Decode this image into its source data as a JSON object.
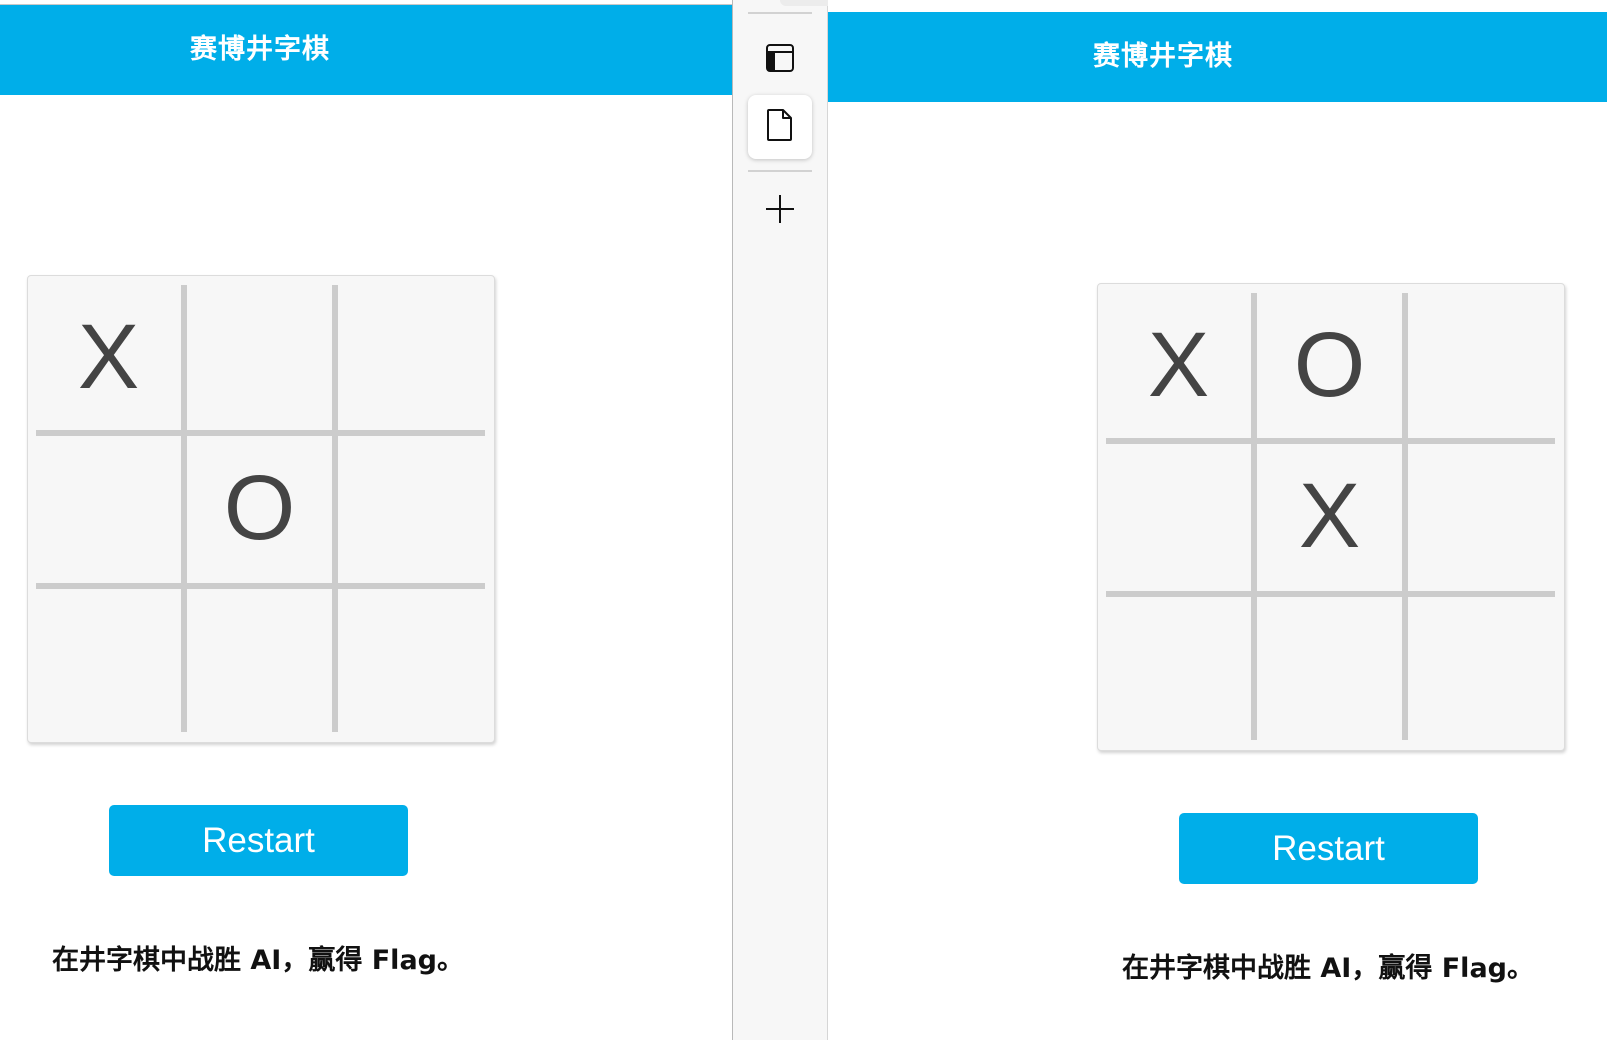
{
  "left_pane": {
    "title": "赛博井字棋",
    "board": [
      "X",
      "",
      "",
      "",
      "O",
      "",
      "",
      "",
      ""
    ],
    "restart_label": "Restart",
    "message": "在井字棋中战胜 AI，赢得 Flag。"
  },
  "right_pane": {
    "title": "赛博井字棋",
    "board": [
      "X",
      "O",
      "",
      "",
      "X",
      "",
      "",
      "",
      ""
    ],
    "restart_label": "Restart",
    "message": "在井字棋中战胜 AI，赢得 Flag。"
  },
  "sidebar": {
    "buttons": [
      {
        "icon": "split-view-icon",
        "active": false
      },
      {
        "icon": "document-icon",
        "active": true
      },
      {
        "icon": "plus-icon",
        "active": false
      }
    ]
  },
  "colors": {
    "accent": "#00aee9",
    "board_bg": "#f7f7f7",
    "grid": "#cccccc",
    "mark": "#444444"
  }
}
